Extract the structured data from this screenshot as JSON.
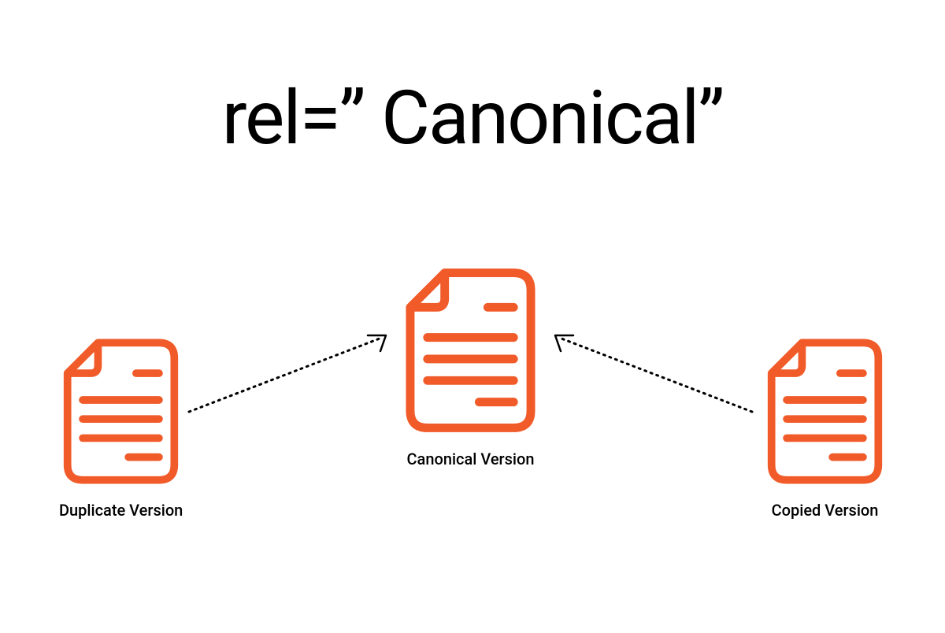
{
  "title": "rel=” Canonical”",
  "nodes": {
    "left": {
      "label": "Duplicate Version"
    },
    "center": {
      "label": "Canonical Version"
    },
    "right": {
      "label": "Copied Version"
    }
  },
  "colors": {
    "icon": "#F15A29",
    "text": "#000000",
    "arrow": "#000000"
  }
}
